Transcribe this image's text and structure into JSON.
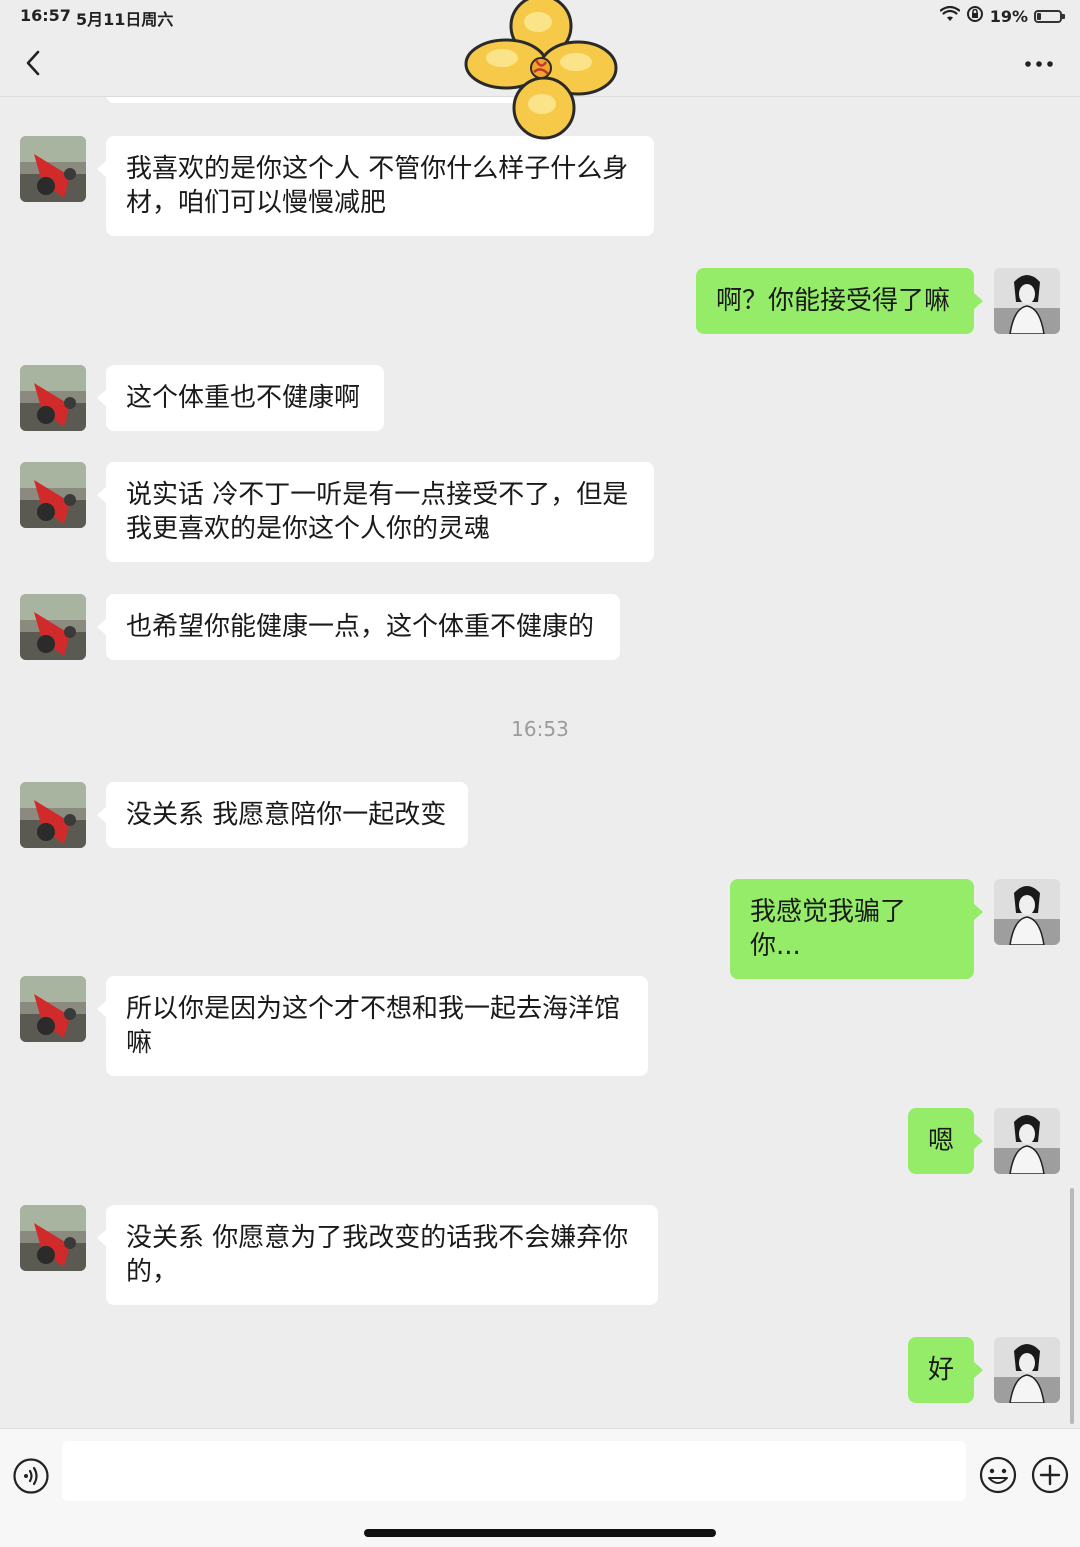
{
  "status_bar": {
    "time": "16:57",
    "date": "5月11日周六",
    "battery_percent": "19%",
    "battery_level": 0.19,
    "icons": [
      "wifi-icon",
      "lock-rotation-icon",
      "battery-icon"
    ]
  },
  "nav": {
    "back_icon": "chevron-left-icon",
    "more_icon": "more-dots-icon"
  },
  "sticker": {
    "icon": "yellow-flower-sticker",
    "color": "#f7c948"
  },
  "colors": {
    "outgoing_bubble": "#95ec69",
    "incoming_bubble": "#ffffff",
    "background": "#ededed"
  },
  "messages": [
    {
      "sender": "other",
      "text": "我喜欢的是你这个人 不管你什么样子什么身材，咱们可以慢慢减肥"
    },
    {
      "sender": "me",
      "text": "啊？你能接受得了嘛"
    },
    {
      "sender": "other",
      "text": "这个体重也不健康啊"
    },
    {
      "sender": "other",
      "text": "说实话 冷不丁一听是有一点接受不了，但是我更喜欢的是你这个人你的灵魂"
    },
    {
      "sender": "other",
      "text": "也希望你能健康一点，这个体重不健康的"
    },
    {
      "sender": "other",
      "text": "没关系 我愿意陪你一起改变"
    },
    {
      "sender": "me",
      "text": "我感觉我骗了你..."
    },
    {
      "sender": "other",
      "text": "所以你是因为这个才不想和我一起去海洋馆嘛"
    },
    {
      "sender": "me",
      "text": "嗯"
    },
    {
      "sender": "other",
      "text": "没关系  你愿意为了我改变的话我不会嫌弃你的，"
    },
    {
      "sender": "me",
      "text": "好"
    }
  ],
  "timestamp_divider": "16:53",
  "input_bar": {
    "voice_icon": "voice-icon",
    "emoji_icon": "emoji-icon",
    "plus_icon": "plus-icon",
    "value": ""
  }
}
